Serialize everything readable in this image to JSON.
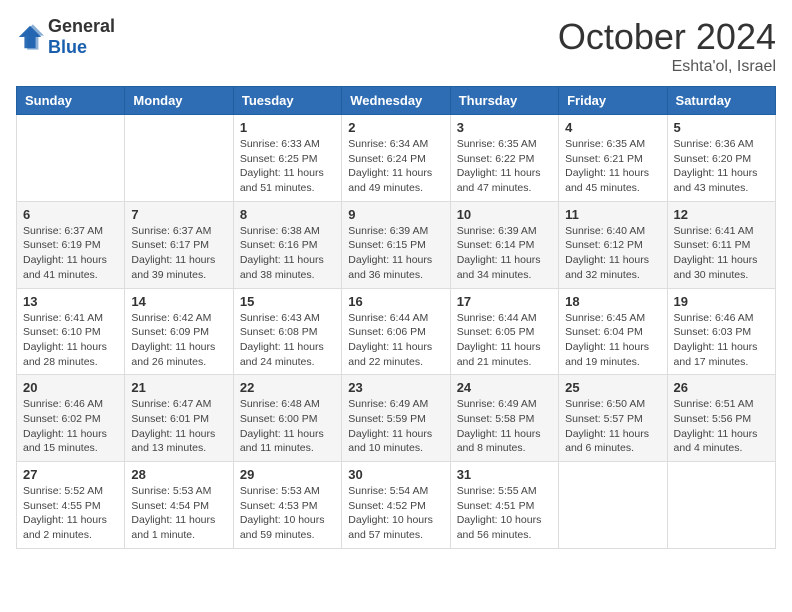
{
  "logo": {
    "general": "General",
    "blue": "Blue"
  },
  "title": {
    "month": "October 2024",
    "location": "Eshta'ol, Israel"
  },
  "headers": [
    "Sunday",
    "Monday",
    "Tuesday",
    "Wednesday",
    "Thursday",
    "Friday",
    "Saturday"
  ],
  "weeks": [
    [
      {
        "day": "",
        "info": ""
      },
      {
        "day": "",
        "info": ""
      },
      {
        "day": "1",
        "info": "Sunrise: 6:33 AM\nSunset: 6:25 PM\nDaylight: 11 hours and 51 minutes."
      },
      {
        "day": "2",
        "info": "Sunrise: 6:34 AM\nSunset: 6:24 PM\nDaylight: 11 hours and 49 minutes."
      },
      {
        "day": "3",
        "info": "Sunrise: 6:35 AM\nSunset: 6:22 PM\nDaylight: 11 hours and 47 minutes."
      },
      {
        "day": "4",
        "info": "Sunrise: 6:35 AM\nSunset: 6:21 PM\nDaylight: 11 hours and 45 minutes."
      },
      {
        "day": "5",
        "info": "Sunrise: 6:36 AM\nSunset: 6:20 PM\nDaylight: 11 hours and 43 minutes."
      }
    ],
    [
      {
        "day": "6",
        "info": "Sunrise: 6:37 AM\nSunset: 6:19 PM\nDaylight: 11 hours and 41 minutes."
      },
      {
        "day": "7",
        "info": "Sunrise: 6:37 AM\nSunset: 6:17 PM\nDaylight: 11 hours and 39 minutes."
      },
      {
        "day": "8",
        "info": "Sunrise: 6:38 AM\nSunset: 6:16 PM\nDaylight: 11 hours and 38 minutes."
      },
      {
        "day": "9",
        "info": "Sunrise: 6:39 AM\nSunset: 6:15 PM\nDaylight: 11 hours and 36 minutes."
      },
      {
        "day": "10",
        "info": "Sunrise: 6:39 AM\nSunset: 6:14 PM\nDaylight: 11 hours and 34 minutes."
      },
      {
        "day": "11",
        "info": "Sunrise: 6:40 AM\nSunset: 6:12 PM\nDaylight: 11 hours and 32 minutes."
      },
      {
        "day": "12",
        "info": "Sunrise: 6:41 AM\nSunset: 6:11 PM\nDaylight: 11 hours and 30 minutes."
      }
    ],
    [
      {
        "day": "13",
        "info": "Sunrise: 6:41 AM\nSunset: 6:10 PM\nDaylight: 11 hours and 28 minutes."
      },
      {
        "day": "14",
        "info": "Sunrise: 6:42 AM\nSunset: 6:09 PM\nDaylight: 11 hours and 26 minutes."
      },
      {
        "day": "15",
        "info": "Sunrise: 6:43 AM\nSunset: 6:08 PM\nDaylight: 11 hours and 24 minutes."
      },
      {
        "day": "16",
        "info": "Sunrise: 6:44 AM\nSunset: 6:06 PM\nDaylight: 11 hours and 22 minutes."
      },
      {
        "day": "17",
        "info": "Sunrise: 6:44 AM\nSunset: 6:05 PM\nDaylight: 11 hours and 21 minutes."
      },
      {
        "day": "18",
        "info": "Sunrise: 6:45 AM\nSunset: 6:04 PM\nDaylight: 11 hours and 19 minutes."
      },
      {
        "day": "19",
        "info": "Sunrise: 6:46 AM\nSunset: 6:03 PM\nDaylight: 11 hours and 17 minutes."
      }
    ],
    [
      {
        "day": "20",
        "info": "Sunrise: 6:46 AM\nSunset: 6:02 PM\nDaylight: 11 hours and 15 minutes."
      },
      {
        "day": "21",
        "info": "Sunrise: 6:47 AM\nSunset: 6:01 PM\nDaylight: 11 hours and 13 minutes."
      },
      {
        "day": "22",
        "info": "Sunrise: 6:48 AM\nSunset: 6:00 PM\nDaylight: 11 hours and 11 minutes."
      },
      {
        "day": "23",
        "info": "Sunrise: 6:49 AM\nSunset: 5:59 PM\nDaylight: 11 hours and 10 minutes."
      },
      {
        "day": "24",
        "info": "Sunrise: 6:49 AM\nSunset: 5:58 PM\nDaylight: 11 hours and 8 minutes."
      },
      {
        "day": "25",
        "info": "Sunrise: 6:50 AM\nSunset: 5:57 PM\nDaylight: 11 hours and 6 minutes."
      },
      {
        "day": "26",
        "info": "Sunrise: 6:51 AM\nSunset: 5:56 PM\nDaylight: 11 hours and 4 minutes."
      }
    ],
    [
      {
        "day": "27",
        "info": "Sunrise: 5:52 AM\nSunset: 4:55 PM\nDaylight: 11 hours and 2 minutes."
      },
      {
        "day": "28",
        "info": "Sunrise: 5:53 AM\nSunset: 4:54 PM\nDaylight: 11 hours and 1 minute."
      },
      {
        "day": "29",
        "info": "Sunrise: 5:53 AM\nSunset: 4:53 PM\nDaylight: 10 hours and 59 minutes."
      },
      {
        "day": "30",
        "info": "Sunrise: 5:54 AM\nSunset: 4:52 PM\nDaylight: 10 hours and 57 minutes."
      },
      {
        "day": "31",
        "info": "Sunrise: 5:55 AM\nSunset: 4:51 PM\nDaylight: 10 hours and 56 minutes."
      },
      {
        "day": "",
        "info": ""
      },
      {
        "day": "",
        "info": ""
      }
    ]
  ]
}
